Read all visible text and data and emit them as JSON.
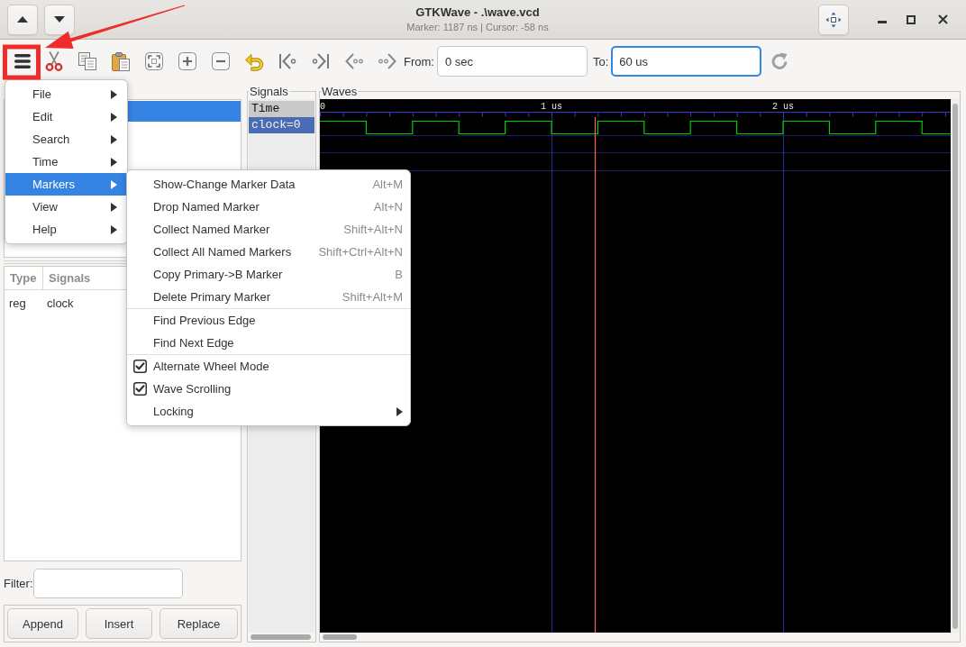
{
  "window": {
    "title": "GTKWave - .\\wave.vcd",
    "subtitle": "Marker: 1187 ns | Cursor: -58 ns"
  },
  "toolbar": {
    "from": {
      "label": "From:",
      "value": "0 sec",
      "focused": false
    },
    "to": {
      "label": "To:",
      "value": "60 us",
      "focused": true
    }
  },
  "hierarchy": {
    "rows": [
      {
        "selected": true
      }
    ]
  },
  "signal_list": {
    "columns": [
      "Type",
      "Signals"
    ],
    "rows": [
      {
        "type": "reg",
        "name": "clock"
      }
    ]
  },
  "filter": {
    "label": "Filter:"
  },
  "buttons": [
    "Append",
    "Insert",
    "Replace"
  ],
  "signals_pane": {
    "title": "Signals",
    "rows": [
      {
        "kind": "time",
        "label": "Time",
        "selected": false
      },
      {
        "kind": "signal",
        "label": "clock=0",
        "selected": true
      }
    ]
  },
  "waves": {
    "title": "Waves",
    "ruler": [
      "0",
      "1 us",
      "2 us"
    ]
  },
  "main_menu": {
    "items": [
      {
        "label": "File",
        "selected": false
      },
      {
        "label": "Edit",
        "selected": false
      },
      {
        "label": "Search",
        "selected": false
      },
      {
        "label": "Time",
        "selected": false
      },
      {
        "label": "Markers",
        "selected": true
      },
      {
        "label": "View",
        "selected": false
      },
      {
        "label": "Help",
        "selected": false
      }
    ]
  },
  "markers_submenu": {
    "items": [
      {
        "kind": "action",
        "label": "Show-Change Marker Data",
        "shortcut": "Alt+M"
      },
      {
        "kind": "action",
        "label": "Drop Named Marker",
        "shortcut": "Alt+N"
      },
      {
        "kind": "action",
        "label": "Collect Named Marker",
        "shortcut": "Shift+Alt+N"
      },
      {
        "kind": "action",
        "label": "Collect All Named Markers",
        "shortcut": "Shift+Ctrl+Alt+N"
      },
      {
        "kind": "action",
        "label": "Copy Primary->B Marker",
        "shortcut": "B"
      },
      {
        "kind": "action",
        "label": "Delete Primary Marker",
        "shortcut": "Shift+Alt+M"
      },
      {
        "kind": "separator"
      },
      {
        "kind": "action",
        "label": "Find Previous Edge"
      },
      {
        "kind": "action",
        "label": "Find Next Edge"
      },
      {
        "kind": "separator"
      },
      {
        "kind": "check",
        "label": "Alternate Wheel Mode",
        "checked": true
      },
      {
        "kind": "check",
        "label": "Wave Scrolling",
        "checked": true
      },
      {
        "kind": "submenu",
        "label": "Locking"
      }
    ]
  },
  "annotations": {
    "highlight_box": true,
    "arrow": true
  }
}
